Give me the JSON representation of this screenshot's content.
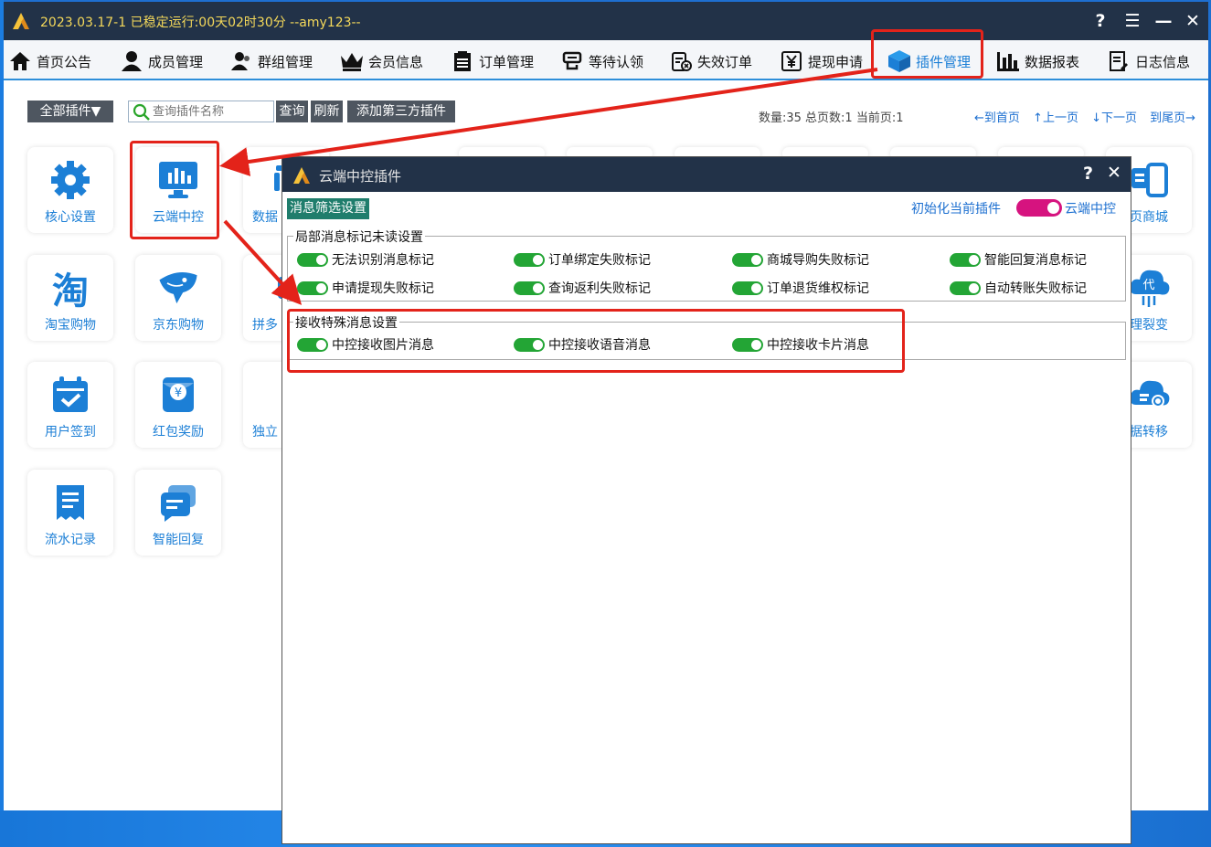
{
  "window": {
    "title": "2023.03.17-1 已稳定运行:00天02时30分  --amy123--",
    "controls": [
      "?",
      "☰",
      "—",
      "✕"
    ]
  },
  "nav": [
    {
      "label": "首页公告",
      "icon": "home-icon"
    },
    {
      "label": "成员管理",
      "icon": "user-icon"
    },
    {
      "label": "群组管理",
      "icon": "users-icon"
    },
    {
      "label": "会员信息",
      "icon": "crown-icon"
    },
    {
      "label": "订单管理",
      "icon": "clipboard-icon"
    },
    {
      "label": "等待认领",
      "icon": "cup-icon"
    },
    {
      "label": "失效订单",
      "icon": "invalid-order-icon"
    },
    {
      "label": "提现申请",
      "icon": "yuan-icon"
    },
    {
      "label": "插件管理",
      "icon": "cube-icon",
      "active": true
    },
    {
      "label": "数据报表",
      "icon": "bar-chart-icon"
    },
    {
      "label": "日志信息",
      "icon": "log-icon"
    }
  ],
  "toolbar": {
    "filter_label": "全部插件▼",
    "search_placeholder": "查询插件名称",
    "query_label": "查询",
    "refresh_label": "刷新",
    "add_label": "添加第三方插件",
    "stats": "数量:35  总页数:1  当前页:1",
    "pager": [
      "←到首页",
      "↑上一页",
      "↓下一页",
      "到尾页→"
    ]
  },
  "plugins": [
    {
      "label": "核心设置",
      "icon": "gear-icon"
    },
    {
      "label": "云端中控",
      "icon": "monitor-chart-icon"
    },
    {
      "label": "数据",
      "icon": "data-icon"
    },
    {
      "label": "页商城",
      "icon": "phone-shop-icon"
    },
    {
      "label": "淘宝购物",
      "icon": "taobao-icon"
    },
    {
      "label": "京东购物",
      "icon": "jd-dog-icon"
    },
    {
      "label": "拼多",
      "icon": "pdd-icon"
    },
    {
      "label": "理裂变",
      "icon": "cloud-agent-icon"
    },
    {
      "label": "用户签到",
      "icon": "calendar-check-icon"
    },
    {
      "label": "红包奖励",
      "icon": "red-packet-icon"
    },
    {
      "label": "独立",
      "icon": "bag-icon"
    },
    {
      "label": "据转移",
      "icon": "cloud-transfer-icon"
    },
    {
      "label": "流水记录",
      "icon": "receipt-icon"
    },
    {
      "label": "智能回复",
      "icon": "chat-reply-icon"
    }
  ],
  "popup": {
    "title": "云端中控插件",
    "help": "?",
    "close": "✕",
    "filter_button": "消息筛选设置",
    "init_link": "初始化当前插件",
    "toggle_label": "云端中控",
    "groups": [
      {
        "title": "局部消息标记未读设置",
        "options": [
          "无法识别消息标记",
          "订单绑定失败标记",
          "商城导购失败标记",
          "智能回复消息标记",
          "申请提现失败标记",
          "查询返利失败标记",
          "订单退货维权标记",
          "自动转账失败标记"
        ]
      },
      {
        "title": "接收特殊消息设置",
        "options": [
          "中控接收图片消息",
          "中控接收语音消息",
          "中控接收卡片消息"
        ]
      }
    ]
  },
  "colors": {
    "titlebar": "#223248",
    "accent": "#1c7fd6",
    "toggle_on": "#23a535",
    "toggle_pink": "#d6137f",
    "highlight": "#e3231a",
    "title_text": "#f5d95a"
  }
}
